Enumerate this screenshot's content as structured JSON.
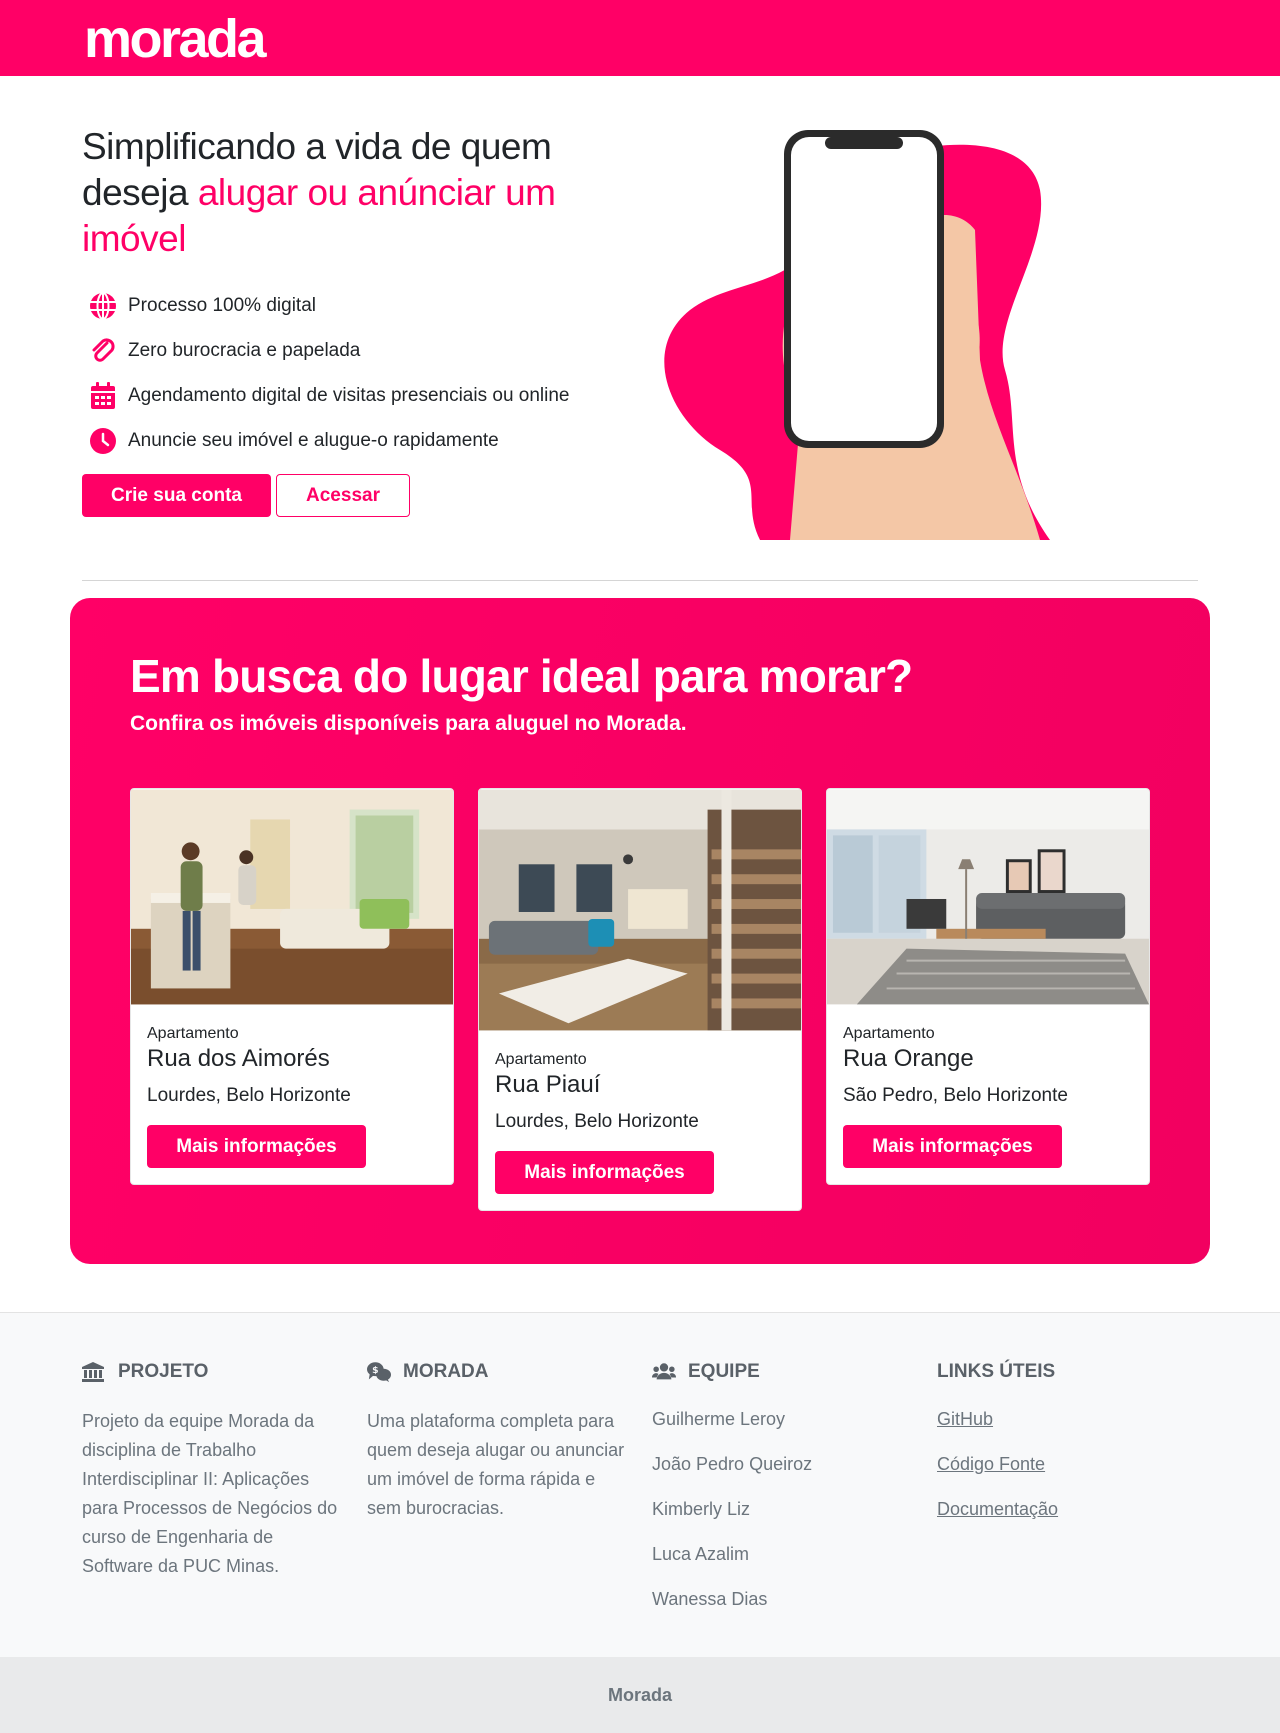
{
  "header": {
    "logo": "morada"
  },
  "hero": {
    "title_part1": "Simplificando a vida de quem deseja ",
    "title_accent": "alugar ou anúnciar um imóvel",
    "features": [
      {
        "icon": "globe-icon",
        "text": "Processo 100% digital"
      },
      {
        "icon": "paperclip-icon",
        "text": "Zero burocracia e papelada"
      },
      {
        "icon": "calendar-icon",
        "text": "Agendamento digital de visitas presenciais ou online"
      },
      {
        "icon": "clock-icon",
        "text": "Anuncie seu imóvel e alugue-o rapidamente"
      }
    ],
    "primary_button": "Crie sua conta",
    "secondary_button": "Acessar"
  },
  "listings": {
    "title": "Em busca do lugar ideal para morar?",
    "subtitle": "Confira os imóveis disponíveis para aluguel no Morada.",
    "cards": [
      {
        "type": "Apartamento",
        "street": "Rua dos Aimorés",
        "location": "Lourdes, Belo Horizonte",
        "button": "Mais informações"
      },
      {
        "type": "Apartamento",
        "street": "Rua Piauí",
        "location": "Lourdes, Belo Horizonte",
        "button": "Mais informações"
      },
      {
        "type": "Apartamento",
        "street": "Rua Orange",
        "location": "São Pedro, Belo Horizonte",
        "button": "Mais informações"
      }
    ]
  },
  "footer": {
    "projeto": {
      "title": "PROJETO",
      "icon": "bank-icon",
      "text": "Projeto da equipe Morada da disciplina de Trabalho Interdisciplinar II: Aplicações para Processos de Negócios do curso de Engenharia de Software da PUC Minas."
    },
    "morada": {
      "title": "MORADA",
      "icon": "chat-icon",
      "text": "Uma plataforma completa para quem deseja alugar ou anunciar um imóvel de forma rápida e sem burocracias."
    },
    "equipe": {
      "title": "EQUIPE",
      "icon": "users-icon",
      "members": [
        "Guilherme Leroy",
        "João Pedro Queiroz",
        "Kimberly Liz",
        "Luca Azalim",
        "Wanessa Dias"
      ]
    },
    "links": {
      "title": "LINKS ÚTEIS",
      "items": [
        "GitHub",
        "Código Fonte",
        "Documentação"
      ]
    }
  },
  "bottom_bar": {
    "text": "Morada"
  },
  "colors": {
    "brand": "#ff0066",
    "muted": "#6c757d",
    "footer_bg": "#f8f9fa"
  }
}
